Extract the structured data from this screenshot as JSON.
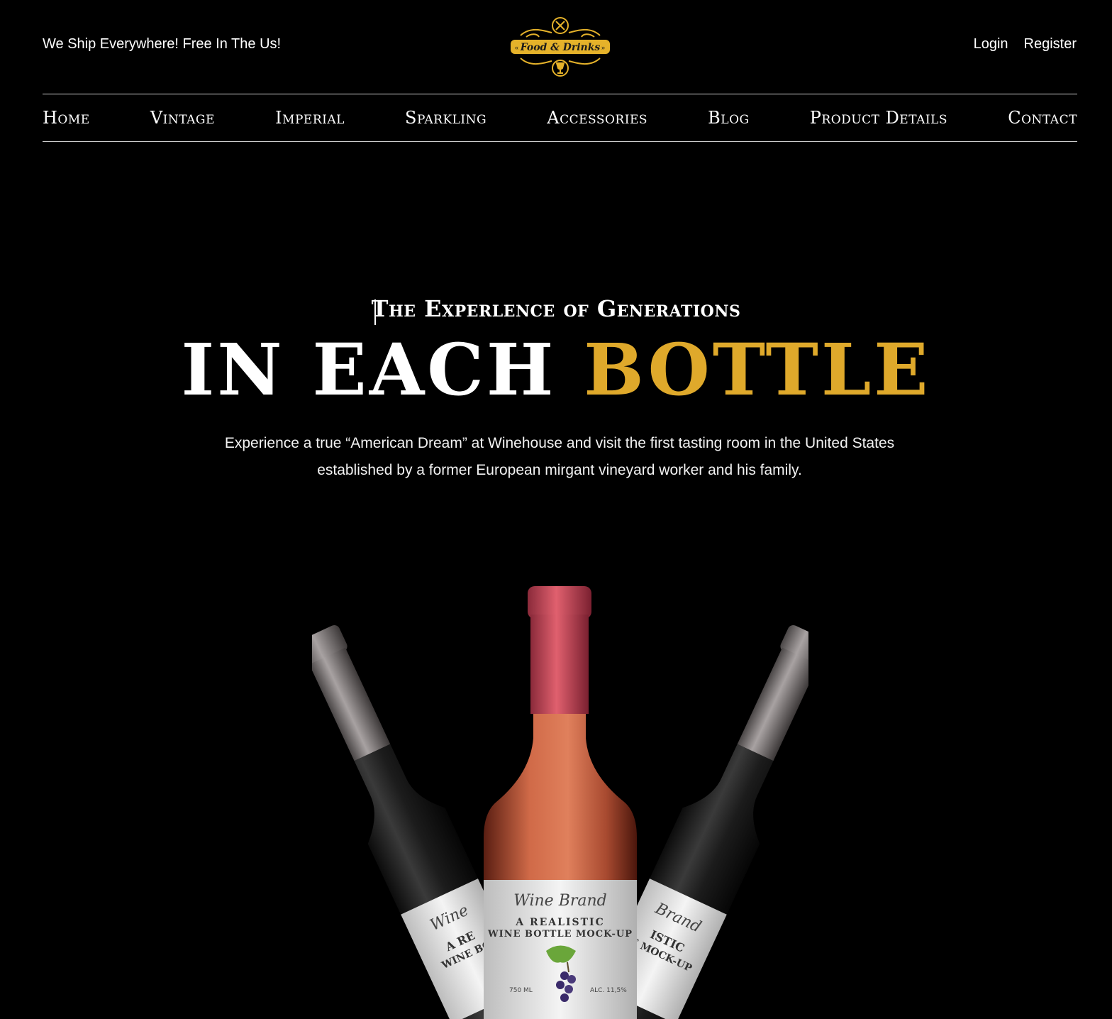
{
  "topbar": {
    "shipping_text": "We Ship Everywhere! Free In The Us!",
    "login_label": "Login",
    "register_label": "Register"
  },
  "logo": {
    "text": "Food & Drinks",
    "icons": [
      "fork-knife-icon",
      "wine-glass-icon"
    ],
    "color": "#e5b22a"
  },
  "nav": {
    "items": [
      {
        "label": "Home"
      },
      {
        "label": "Vintage"
      },
      {
        "label": "Imperial"
      },
      {
        "label": "Sparkling"
      },
      {
        "label": "Accessories"
      },
      {
        "label": "Blog"
      },
      {
        "label": "Product Details"
      },
      {
        "label": "Contact"
      }
    ]
  },
  "hero": {
    "subtitle": "The Experlence of Generations",
    "headline_white": "IN EACH ",
    "headline_gold": "BOTTLE",
    "accent_color": "#dfa92b",
    "description": "Experience a true “American Dream” at Winehouse and visit the first tasting room in the United States established by a former European mirgant vineyard worker and his family."
  },
  "bottles": {
    "center_label_brand": "Wine Brand",
    "center_label_line1": "A REALISTIC",
    "center_label_line2": "WINE BOTTLE MOCK-UP",
    "center_label_volume": "750 ML",
    "center_label_alc": "ALC. 11,5%",
    "left_label_brand": "Wine",
    "left_label_line1": "A RE",
    "left_label_line2": "WINE BO",
    "right_label_brand": "Brand",
    "right_label_line1": "ISTIC",
    "right_label_line2": "E MOCK-UP"
  }
}
